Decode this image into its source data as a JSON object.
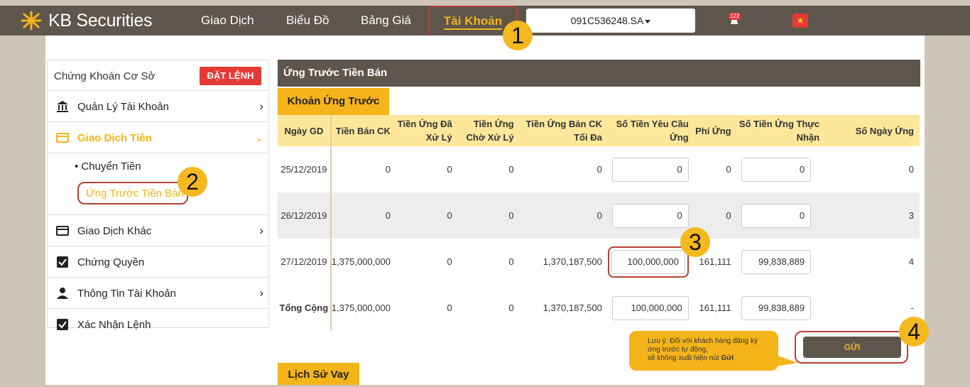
{
  "brand": "KB Securities",
  "nav": {
    "items": [
      "Giao Dịch",
      "Biểu Đồ",
      "Bảng Giá"
    ],
    "active": "Tài Khoản",
    "account": "091C536248.SA",
    "notification_count": "122",
    "flag_icon": "vietnam-flag-icon"
  },
  "sidebar": {
    "title": "Chứng Khoán Cơ Sở",
    "order_button": "ĐẶT LỆNH",
    "items": [
      {
        "label": "Quản Lý Tài Khoản"
      },
      {
        "label": "Giao Dịch Tiền"
      },
      {
        "label": "Giao Dịch Khác"
      },
      {
        "label": "Chứng Quyền"
      },
      {
        "label": "Thông Tin Tài Khoản"
      },
      {
        "label": "Xác Nhận Lệnh"
      }
    ],
    "sub_items": [
      "Chuyển Tiền",
      "Ứng Trước Tiền Bán"
    ]
  },
  "panel": {
    "title": "Ứng Trước Tiền Bán",
    "tab": "Khoản Ứng Trước",
    "columns": [
      "Ngày GD",
      "Tiền Bán CK",
      "Tiền Ứng Đã Xử Lý",
      "Tiền Ứng Chờ Xử Lý",
      "Tiền Ứng Bán CK Tối Đa",
      "Số Tiền Yêu Cầu Ứng",
      "Phí Ứng",
      "Số Tiền Ứng Thực Nhận",
      "Số Ngày Ứng"
    ],
    "rows": [
      {
        "date": "25/12/2019",
        "sold": "0",
        "processed": "0",
        "pending": "0",
        "max": "0",
        "request": "0",
        "fee": "0",
        "received": "0",
        "days": "0"
      },
      {
        "date": "26/12/2019",
        "sold": "0",
        "processed": "0",
        "pending": "0",
        "max": "0",
        "request": "0",
        "fee": "0",
        "received": "0",
        "days": "3"
      },
      {
        "date": "27/12/2019",
        "sold": "1,375,000,000",
        "processed": "0",
        "pending": "0",
        "max": "1,370,187,500",
        "request": "100,000,000",
        "fee": "161,111",
        "received": "99,838,889",
        "days": "4"
      }
    ],
    "total": {
      "label": "Tổng Cộng",
      "sold": "1,375,000,000",
      "processed": "0",
      "pending": "0",
      "max": "1,370,187,500",
      "request": "100,000,000",
      "fee": "161,111",
      "received": "99,838,889",
      "days": "-"
    }
  },
  "note": {
    "line1": "Lưu ý: Đối với khách hàng đăng ký",
    "line2": "ứng trước tự động,",
    "line3": "sẽ không xuất hiện nút ",
    "bold": "Gửi"
  },
  "submit": "GỬI",
  "history_tab": "Lịch Sử Vay",
  "callouts": [
    "1",
    "2",
    "3",
    "4"
  ],
  "colors": {
    "nav_bg": "#5e564d",
    "accent": "#f4b41a",
    "alert": "#e53935"
  }
}
